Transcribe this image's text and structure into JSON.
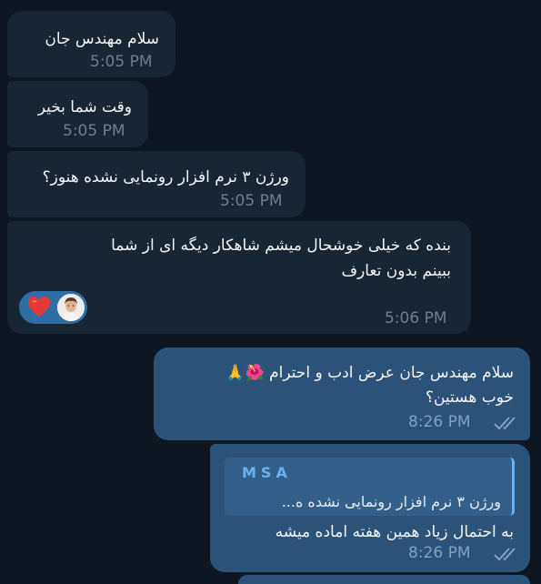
{
  "messages": [
    {
      "text": "سلام مهندس جان",
      "time": "5:05 PM"
    },
    {
      "text": "وقت شما بخیر",
      "time": "5:05 PM"
    },
    {
      "text": "ورژن ۳ نرم افزار رونمایی نشده هنوز؟",
      "time": "5:05 PM"
    },
    {
      "text_line1": "بنده که خیلی خوشحال میشم شاهکار دیگه ای از شما",
      "text_line2": "ببینم بدون تعارف",
      "time": "5:06 PM",
      "reaction_icon": "heart-icon"
    },
    {
      "text_line1": "سلام مهندس جان عرض ادب و احترام 🌺🙏",
      "text_line2": "خوب هستین؟",
      "time": "8:26 PM"
    },
    {
      "reply_name": "MSA",
      "reply_text": "ورژن ۳ نرم افزار رونمایی نشده ه...",
      "text": "به احتمال زیاد همین هفته اماده میشه",
      "time": "8:26 PM"
    }
  ],
  "colors": {
    "background": "#0e1621",
    "incoming": "#182533",
    "outgoing": "#2b5278",
    "accent": "#6ab2f2"
  }
}
